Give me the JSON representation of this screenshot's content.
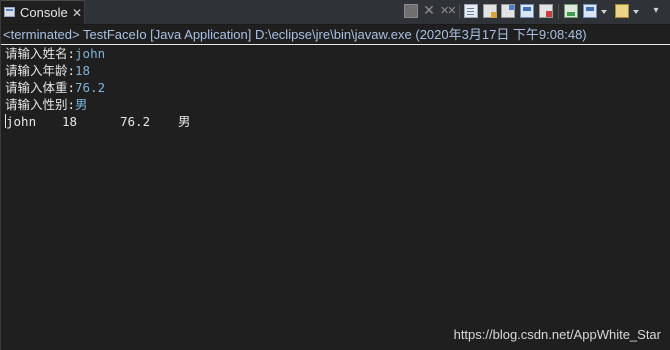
{
  "tab": {
    "label": "Console",
    "close_symbol": "✕",
    "icon": "console-icon"
  },
  "toolbar": {
    "icons": [
      "terminate-icon",
      "remove-launch-icon",
      "remove-all-terminated-icon",
      "clear-console-icon",
      "scroll-lock-icon",
      "word-wrap-icon",
      "show-on-stdout-icon",
      "show-on-stderr-icon",
      "pin-console-icon",
      "display-selected-console-icon",
      "open-console-icon",
      "view-menu-icon"
    ]
  },
  "status": {
    "text": "<terminated> TestFaceIo [Java Application] D:\\eclipse\\jre\\bin\\javaw.exe (2020年3月17日 下午9:08:48)"
  },
  "console": {
    "lines": [
      {
        "prompt": "请输入姓名:",
        "input": "john"
      },
      {
        "prompt": "请输入年龄:",
        "input": "18"
      },
      {
        "prompt": "请输入体重:",
        "input": "76.2"
      },
      {
        "prompt": "请输入性别:",
        "input": "男"
      }
    ],
    "output": [
      "john",
      "18",
      "76.2",
      "男"
    ]
  },
  "colors": {
    "background": "#1f1f1f",
    "status_text": "#a9c0e4",
    "prompt_text": "#e6e6e6",
    "input_text": "#7fb3d5"
  },
  "watermark": {
    "text": "https://blog.csdn.net/AppWhite_Star"
  }
}
